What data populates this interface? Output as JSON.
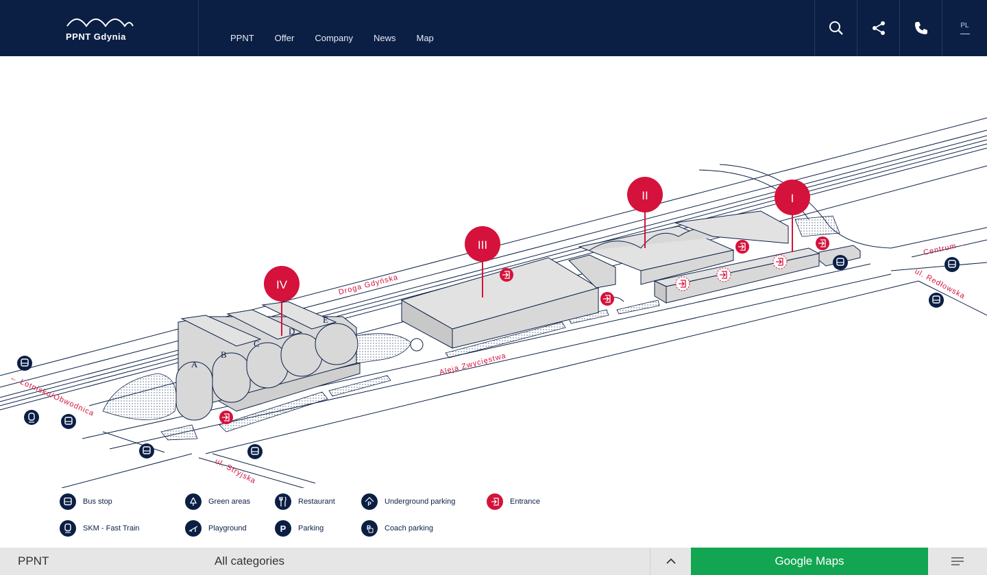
{
  "header": {
    "logo_text": "PPNT Gdynia",
    "nav": [
      "PPNT",
      "Offer",
      "Company",
      "News",
      "Map"
    ],
    "icons": [
      "search-icon",
      "share-icon",
      "phone-icon"
    ],
    "lang": "PL"
  },
  "map": {
    "streets": {
      "droga": "Droga Gdyńska",
      "aleja": "Aleja Zwycięstwa",
      "lotnisko": "← Lotnisko/Obwodnica",
      "centrum": "Centrum →",
      "redlowska": "ul. Redłowska",
      "stryjska": "ul. Stryjska"
    },
    "building_markers": [
      "IV",
      "III",
      "II",
      "I"
    ],
    "wing_labels": [
      "A",
      "B",
      "C",
      "D",
      "E"
    ],
    "colors": {
      "navy": "#0b1f45",
      "red": "#d5123b",
      "building": "#d8d8d8",
      "green": "#12a552"
    }
  },
  "legend": [
    {
      "label": "Bus stop",
      "icon": "bus-icon"
    },
    {
      "label": "Green areas",
      "icon": "tree-icon"
    },
    {
      "label": "Restaurant",
      "icon": "fork-knife-icon"
    },
    {
      "label": "Underground parking",
      "icon": "underground-parking-icon"
    },
    {
      "label": "Entrance",
      "icon": "entrance-icon"
    },
    {
      "label": "SKM - Fast Train",
      "icon": "train-icon"
    },
    {
      "label": "Playground",
      "icon": "playground-icon"
    },
    {
      "label": "Parking",
      "icon": "parking-icon"
    },
    {
      "label": "Coach parking",
      "icon": "coach-parking-icon"
    }
  ],
  "footer": {
    "left": "PPNT",
    "category": "All categories",
    "google_maps": "Google Maps"
  }
}
